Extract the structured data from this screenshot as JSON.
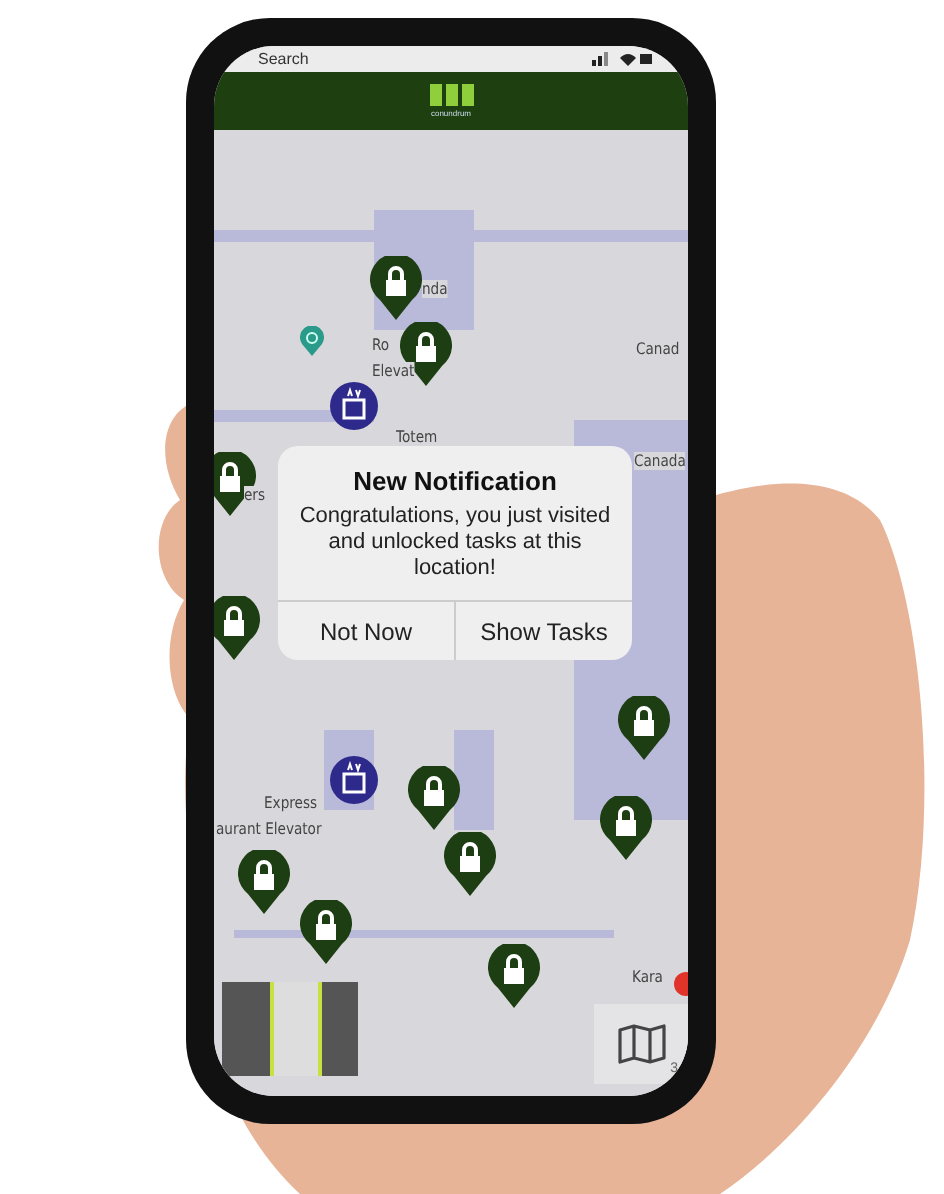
{
  "status_bar": {
    "back_label": "Search"
  },
  "header": {
    "logo_text": "conundrum"
  },
  "map": {
    "labels": [
      {
        "text": "nda"
      },
      {
        "text": "Ro"
      },
      {
        "text": "Elevat"
      },
      {
        "text": "Canad"
      },
      {
        "text": "Totem"
      },
      {
        "text": "Canada"
      },
      {
        "text": "ers"
      },
      {
        "text": "Express"
      },
      {
        "text": "aurant Elevator"
      },
      {
        "text": "Kara"
      }
    ],
    "map_button": {
      "badge": "3"
    }
  },
  "dialog": {
    "title": "New Notification",
    "message": "Congratulations, you just visited and unlocked tasks at this location!",
    "buttons": [
      "Not Now",
      "Show Tasks"
    ]
  }
}
